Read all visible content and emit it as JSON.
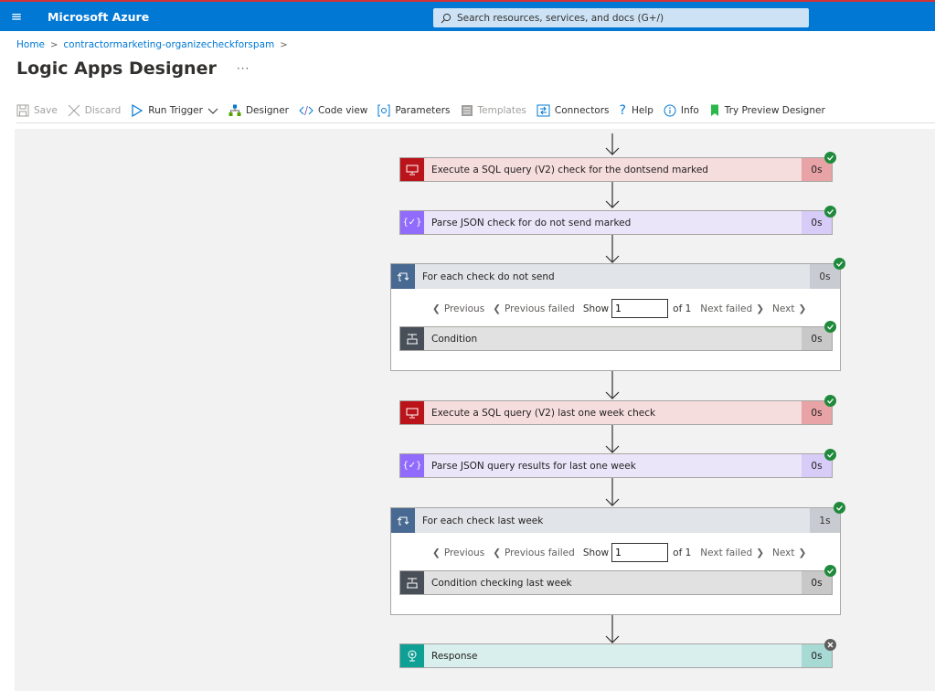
{
  "topbar": {
    "brand": "Microsoft Azure",
    "search_placeholder": "Search resources, services, and docs (G+/)"
  },
  "breadcrumb": {
    "home": "Home",
    "resource": "contractormarketing-organizecheckforspam"
  },
  "page_title": "Logic Apps Designer",
  "more_label": "···",
  "toolbar": {
    "save": "Save",
    "discard": "Discard",
    "run_trigger": "Run Trigger",
    "designer": "Designer",
    "code_view": "Code view",
    "parameters": "Parameters",
    "templates": "Templates",
    "connectors": "Connectors",
    "help": "Help",
    "info": "Info",
    "try_preview": "Try Preview Designer"
  },
  "flow": {
    "step1": {
      "label": "Execute a SQL query (V2) check for the dontsend marked",
      "duration": "0s",
      "status": "succeeded"
    },
    "step2": {
      "label": "Parse JSON check for do not send marked",
      "duration": "0s",
      "status": "succeeded"
    },
    "loop1": {
      "label": "For each check do not send",
      "duration": "0s",
      "status": "succeeded",
      "pager": {
        "previous": "Previous",
        "previous_failed": "Previous failed",
        "show": "Show",
        "value": "1",
        "of": "of 1",
        "next_failed": "Next failed",
        "next": "Next"
      },
      "inner": {
        "label": "Condition",
        "duration": "0s",
        "status": "succeeded"
      }
    },
    "step3": {
      "label": "Execute a SQL query (V2) last one week check",
      "duration": "0s",
      "status": "succeeded"
    },
    "step4": {
      "label": "Parse JSON query results for last one week",
      "duration": "0s",
      "status": "succeeded"
    },
    "loop2": {
      "label": "For each check last week",
      "duration": "1s",
      "status": "succeeded",
      "pager": {
        "previous": "Previous",
        "previous_failed": "Previous failed",
        "show": "Show",
        "value": "1",
        "of": "of 1",
        "next_failed": "Next failed",
        "next": "Next"
      },
      "inner": {
        "label": "Condition checking last week",
        "duration": "0s",
        "status": "succeeded"
      }
    },
    "step5": {
      "label": "Response",
      "duration": "0s",
      "status": "failed"
    }
  },
  "colors": {
    "azure_blue": "#0078d4",
    "sql_red": "#ba141a",
    "json_purple": "#916cfc",
    "loop_blue": "#486991",
    "condition_gray": "#484f58",
    "response_teal": "#0e9f95",
    "success_green": "#1f8a3b"
  }
}
